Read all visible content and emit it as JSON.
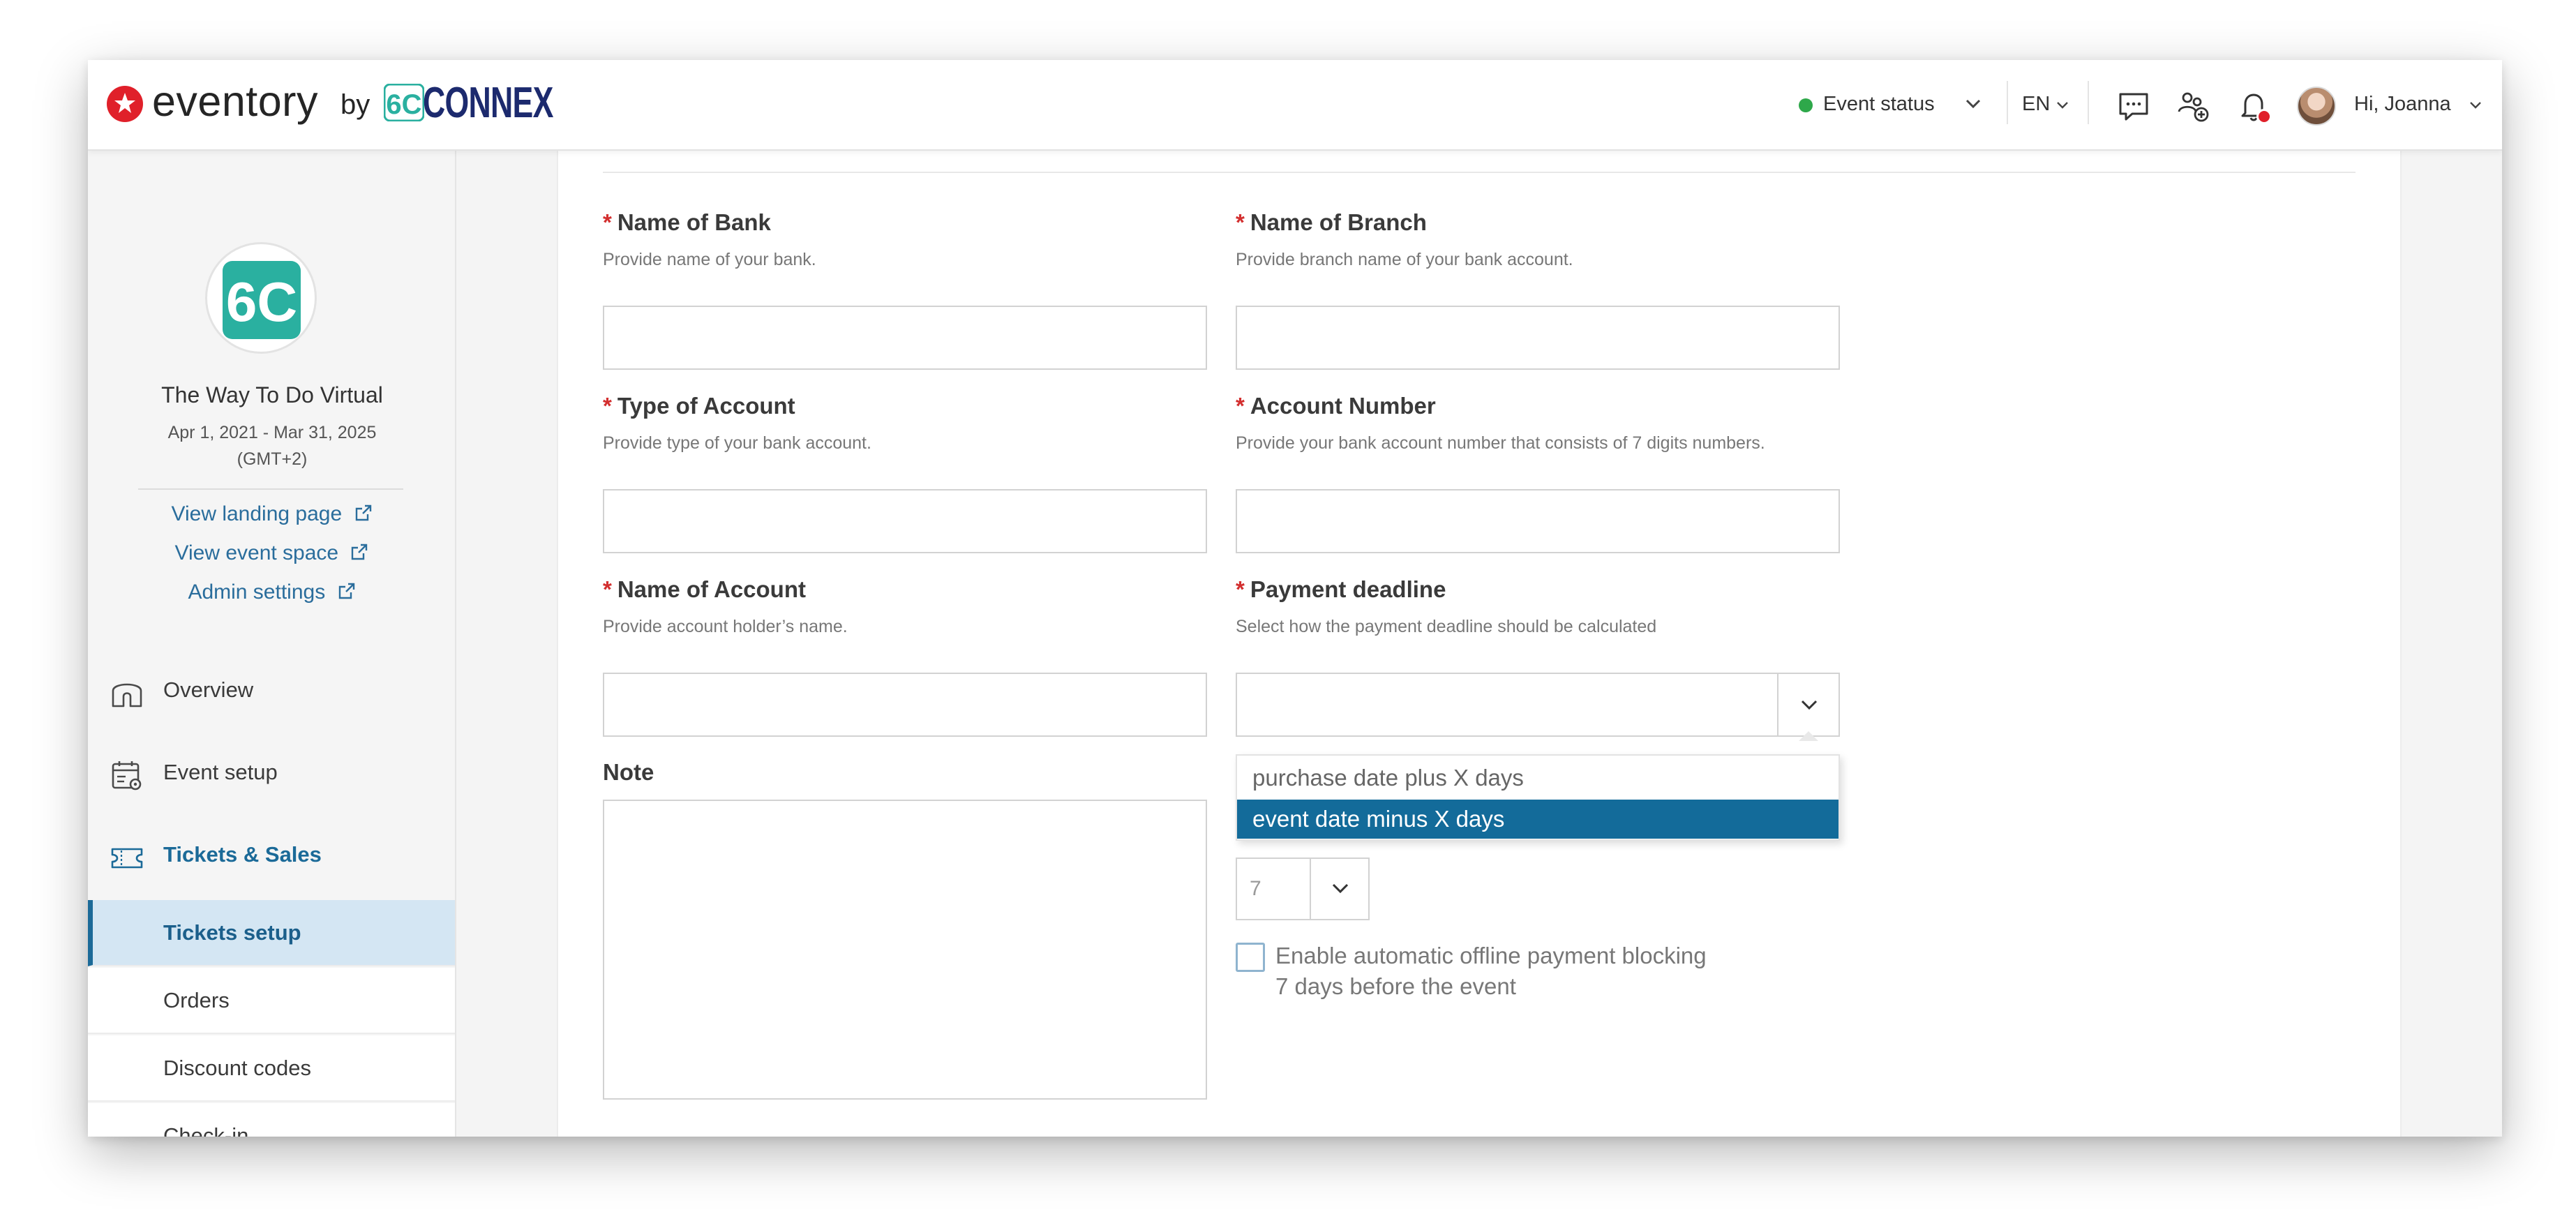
{
  "brand": {
    "product": "eventory",
    "by": "by",
    "partner": "CONNEX",
    "partner_mark": "6C"
  },
  "topbar": {
    "event_status_label": "Event status",
    "event_status_color": "#2ea84a",
    "language": "EN",
    "greeting": "Hi, Joanna",
    "icons": [
      "chat-icon",
      "add-users-icon",
      "bell-icon"
    ],
    "notification_dot_color": "#e0202a"
  },
  "sidebar": {
    "event_logo_text": "6C",
    "event_title": "The Way To Do Virtual",
    "event_dates": "Apr 1, 2021 - Mar 31, 2025",
    "event_timezone": "(GMT+2)",
    "links": {
      "landing": "View landing page",
      "space": "View event space",
      "admin": "Admin settings"
    },
    "nav": {
      "overview": "Overview",
      "event_setup": "Event setup",
      "tickets_sales": "Tickets & Sales"
    },
    "sub_nav": {
      "tickets_setup": "Tickets setup",
      "orders": "Orders",
      "discount_codes": "Discount codes",
      "check_in": "Check-in"
    },
    "accent_color": "#1b6a98"
  },
  "form": {
    "bank_name": {
      "label": "Name of Bank",
      "help": "Provide name of your bank.",
      "value": ""
    },
    "branch_name": {
      "label": "Name of Branch",
      "help": "Provide branch name of your bank account.",
      "value": ""
    },
    "account_type": {
      "label": "Type of Account",
      "help": "Provide type of your bank account.",
      "value": ""
    },
    "account_number": {
      "label": "Account Number",
      "help": "Provide your bank account number that consists of 7 digits numbers.",
      "value": ""
    },
    "account_name": {
      "label": "Name of Account",
      "help": "Provide account holder’s name.",
      "value": ""
    },
    "payment_deadline": {
      "label": "Payment deadline",
      "help": "Select how the payment deadline should be calculated",
      "value": "",
      "options": [
        "purchase date plus X days",
        "event date minus X days"
      ],
      "highlighted_option": "event date minus X days"
    },
    "note": {
      "label": "Note",
      "value": ""
    },
    "days": {
      "value": "7"
    },
    "offline_blocking": {
      "line1": "Enable automatic offline payment blocking",
      "line2": "7 days before the event",
      "checked": false
    },
    "required_marker": "*",
    "highlight_color": "#136b9a"
  }
}
